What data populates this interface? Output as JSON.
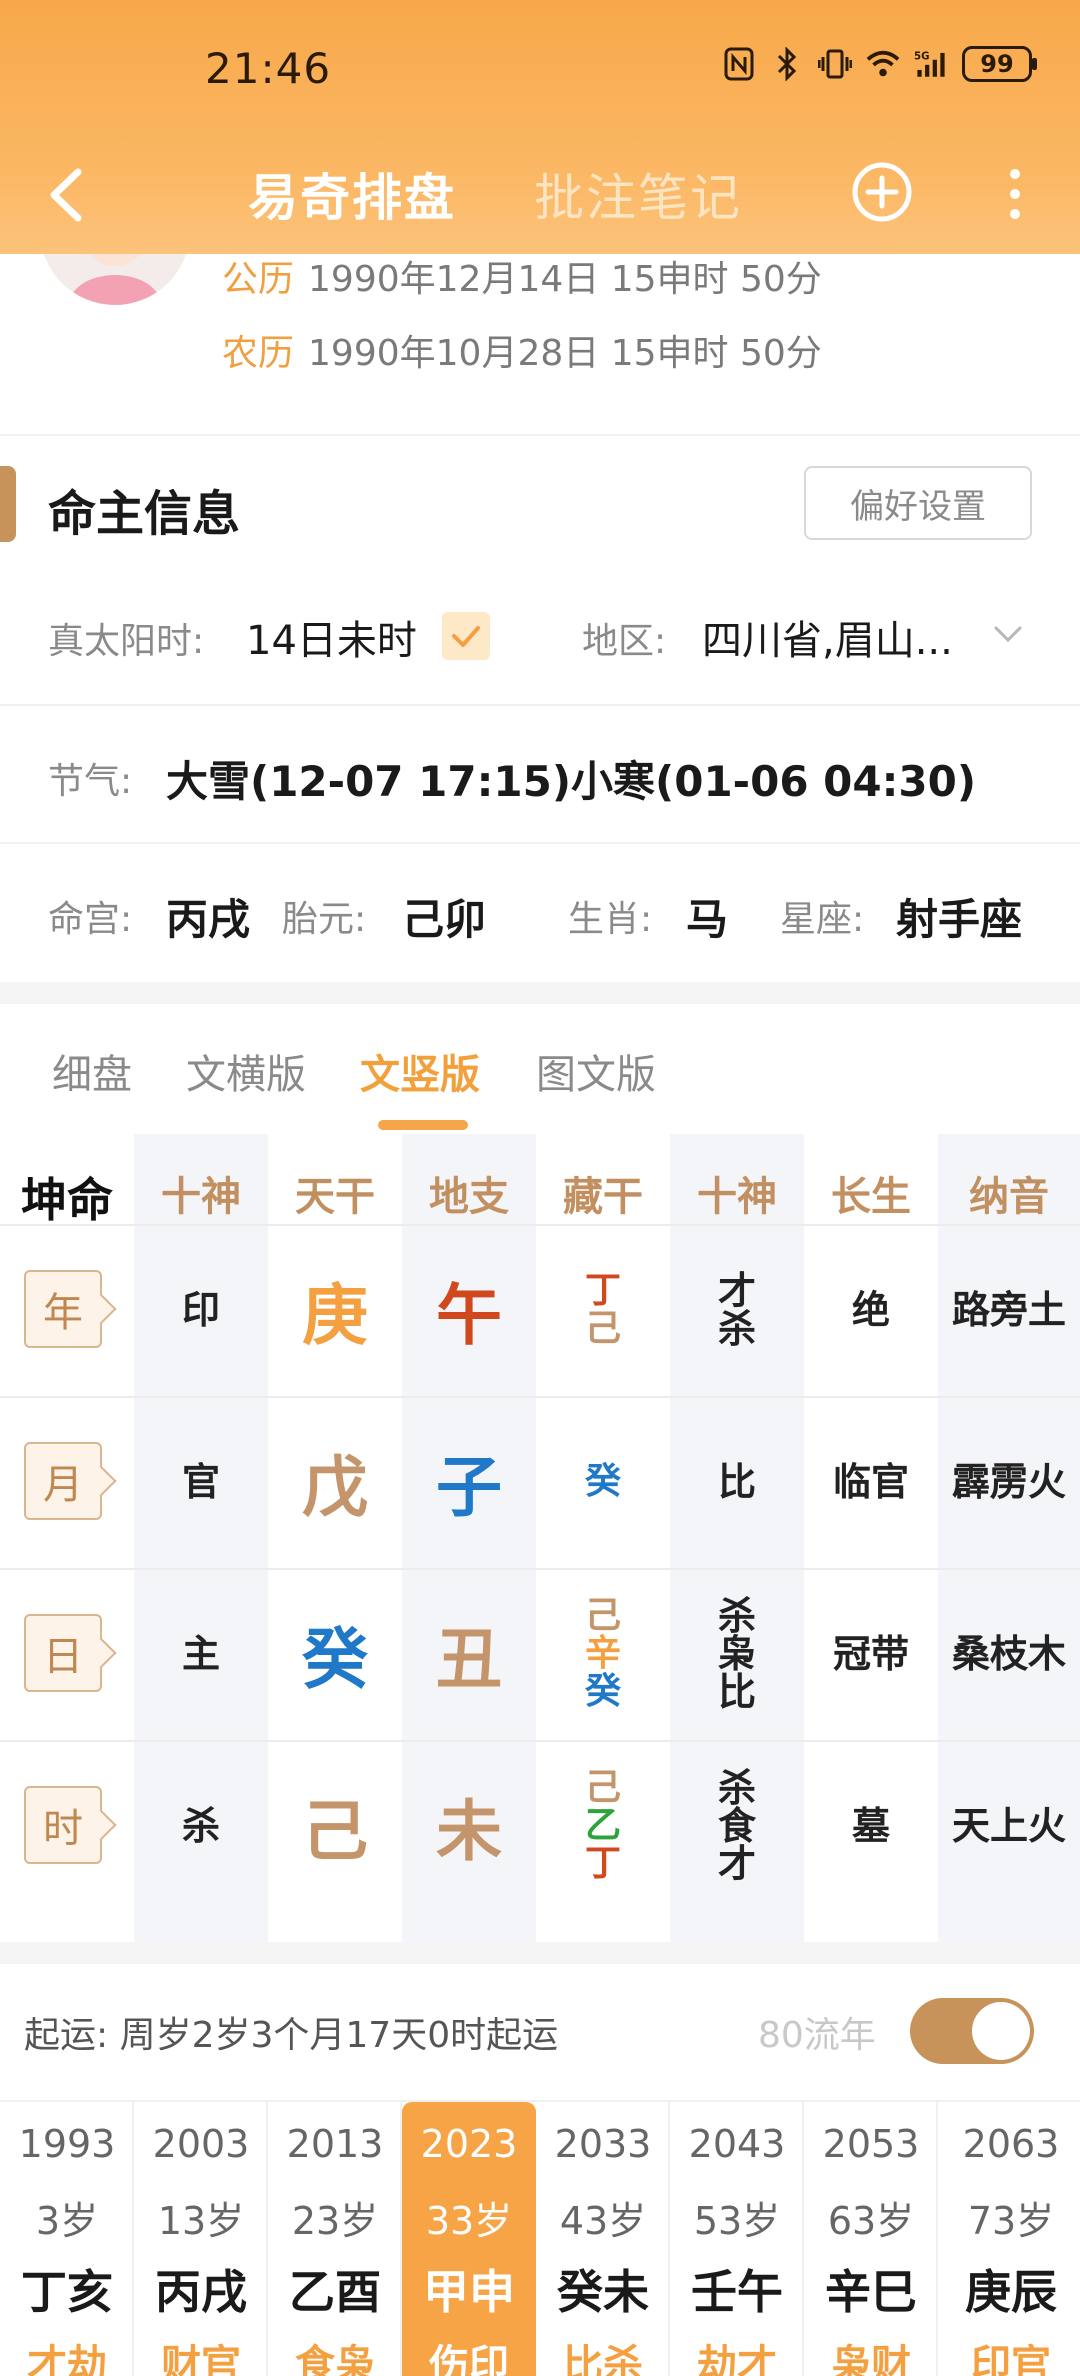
{
  "status": {
    "time": "21:46",
    "battery": "99"
  },
  "nav": {
    "title": "易奇排盘",
    "notes": "批注笔记"
  },
  "profile": {
    "solar_label": "公历",
    "solar_value": "1990年12月14日 15申时 50分",
    "lunar_label": "农历",
    "lunar_value": "1990年10月28日 15申时 50分"
  },
  "info": {
    "title": "命主信息",
    "pref_button": "偏好设置",
    "true_solar_label": "真太阳时:",
    "true_solar_value": "14日未时",
    "region_label": "地区:",
    "region_value": "四川省,眉山...",
    "jieqi_label": "节气:",
    "jieqi_value": "大雪(12-07 17:15)小寒(01-06 04:30)",
    "minggong_label": "命宫:",
    "minggong_value": "丙戌",
    "taiyuan_label": "胎元:",
    "taiyuan_value": "己卯",
    "shengxiao_label": "生肖:",
    "shengxiao_value": "马",
    "xingzuo_label": "星座:",
    "xingzuo_value": "射手座"
  },
  "tabs": [
    "细盘",
    "文横版",
    "文竖版",
    "图文版"
  ],
  "active_tab": "文竖版",
  "grid": {
    "headers": [
      "坤命",
      "十神",
      "天干",
      "地支",
      "藏干",
      "十神",
      "长生",
      "纳音"
    ],
    "rows": [
      {
        "label": "年",
        "ten": "印",
        "stem": "庚",
        "stem_color": "#f5a040",
        "branch": "午",
        "branch_color": "#d0481c",
        "hidden": [
          {
            "c": "丁",
            "color": "#d0481c"
          },
          {
            "c": "己",
            "color": "#c4956a"
          }
        ],
        "ten2": [
          "才",
          "杀"
        ],
        "changsheng": "绝",
        "nayin": "路旁土"
      },
      {
        "label": "月",
        "ten": "官",
        "stem": "戊",
        "stem_color": "#c4956a",
        "branch": "子",
        "branch_color": "#1f78c8",
        "hidden": [
          {
            "c": "癸",
            "color": "#1f78c8"
          }
        ],
        "ten2": [
          "比"
        ],
        "changsheng": "临官",
        "nayin": "霹雳火"
      },
      {
        "label": "日",
        "ten": "主",
        "stem": "癸",
        "stem_color": "#1f78c8",
        "branch": "丑",
        "branch_color": "#c4956a",
        "hidden": [
          {
            "c": "己",
            "color": "#c4956a"
          },
          {
            "c": "辛",
            "color": "#f5a040"
          },
          {
            "c": "癸",
            "color": "#1f78c8"
          }
        ],
        "ten2": [
          "杀",
          "枭",
          "比"
        ],
        "changsheng": "冠带",
        "nayin": "桑枝木"
      },
      {
        "label": "时",
        "ten": "杀",
        "stem": "己",
        "stem_color": "#c4956a",
        "branch": "未",
        "branch_color": "#c4956a",
        "hidden": [
          {
            "c": "己",
            "color": "#c4956a"
          },
          {
            "c": "乙",
            "color": "#2ea33a"
          },
          {
            "c": "丁",
            "color": "#d0481c"
          }
        ],
        "ten2": [
          "杀",
          "食",
          "才"
        ],
        "changsheng": "墓",
        "nayin": "天上火"
      }
    ]
  },
  "qiyun": {
    "text": "起运:  周岁2岁3个月17天0时起运",
    "flow_label": "80流年",
    "toggle_on": true
  },
  "dayun": [
    {
      "year": "1993",
      "age": "3岁",
      "ganzhi": "丁亥",
      "ten": "才劫",
      "ten_color": "#f5a040"
    },
    {
      "year": "2003",
      "age": "13岁",
      "ganzhi": "丙戌",
      "ten": "财官",
      "ten_color": "#f5a040"
    },
    {
      "year": "2013",
      "age": "23岁",
      "ganzhi": "乙酉",
      "ten": "食枭",
      "ten_color": "#f5a040"
    },
    {
      "year": "2023",
      "age": "33岁",
      "ganzhi": "甲申",
      "ten": "伤印",
      "ten_color": "#ffffff",
      "active": true
    },
    {
      "year": "2033",
      "age": "43岁",
      "ganzhi": "癸未",
      "ten": "比杀",
      "ten_color": "#f5a040"
    },
    {
      "year": "2043",
      "age": "53岁",
      "ganzhi": "壬午",
      "ten": "劫才",
      "ten_color": "#f5a040"
    },
    {
      "year": "2053",
      "age": "63岁",
      "ganzhi": "辛巳",
      "ten": "枭财",
      "ten_color": "#f5a040"
    },
    {
      "year": "2063",
      "age": "73岁",
      "ganzhi": "庚辰",
      "ten": "印官",
      "ten_color": "#f5a040"
    }
  ],
  "icons": [
    "back-arrow-icon",
    "add-circle-icon",
    "more-vertical-icon",
    "nfc-icon",
    "bluetooth-icon",
    "vibrate-icon",
    "wifi-icon",
    "signal-5g-icon",
    "battery-icon",
    "check-icon",
    "chevron-down-icon"
  ]
}
